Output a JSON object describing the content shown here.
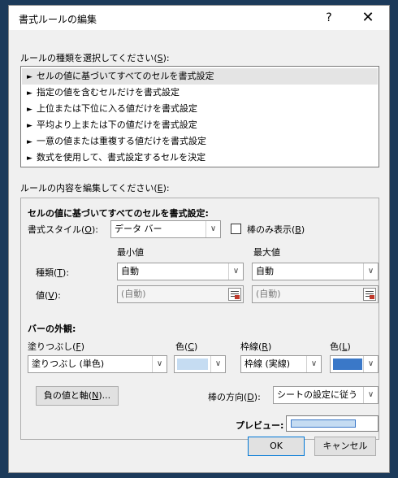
{
  "window": {
    "title": "書式ルールの編集",
    "help": "?",
    "close": "✕"
  },
  "rule_type_label": "ルールの種類を選択してください(",
  "rule_type_key": "S",
  "rule_type_suffix": "):",
  "rules": [
    "セルの値に基づいてすべてのセルを書式設定",
    "指定の値を含むセルだけを書式設定",
    "上位または下位に入る値だけを書式設定",
    "平均より上または下の値だけを書式設定",
    "一意の値または重複する値だけを書式設定",
    "数式を使用して、書式設定するセルを決定"
  ],
  "rule_arrow": "►",
  "edit_label": "ルールの内容を編集してください(",
  "edit_key": "E",
  "edit_suffix": "):",
  "edit": {
    "heading": "セルの値に基づいてすべてのセルを書式設定:",
    "format_style_label": "書式スタイル(",
    "format_style_key": "O",
    "format_style_suffix": "):",
    "format_style_value": "データ バー",
    "bar_only_label": "棒のみ表示(",
    "bar_only_key": "B",
    "bar_only_suffix": ")",
    "min_heading": "最小値",
    "max_heading": "最大値",
    "type_label": "種類(",
    "type_key": "T",
    "type_suffix": "):",
    "min_type": "自動",
    "max_type": "自動",
    "value_label": "値(",
    "value_key": "V",
    "value_suffix": "):",
    "min_value": "(自動)",
    "max_value": "(自動)"
  },
  "bar": {
    "heading": "バーの外観:",
    "fill_label": "塗りつぶし(",
    "fill_key": "F",
    "fill_suffix": ")",
    "fill_value": "塗りつぶし (単色)",
    "fill_color_label": "色(",
    "fill_color_key": "C",
    "fill_color_suffix": ")",
    "fill_color": "#c5dcf2",
    "border_label": "枠線(",
    "border_key": "R",
    "border_suffix": ")",
    "border_value": "枠線 (実線)",
    "border_color_label": "色(",
    "border_color_key": "L",
    "border_color_suffix": ")",
    "border_color": "#3a78c8",
    "neg_axis_button": "負の値と軸(",
    "neg_axis_key": "N",
    "neg_axis_suffix": ")...",
    "direction_label": "棒の方向(",
    "direction_key": "D",
    "direction_suffix": "):",
    "direction_value": "シートの設定に従う",
    "preview_label": "プレビュー:"
  },
  "buttons": {
    "ok": "OK",
    "cancel": "キャンセル"
  },
  "dropdown_arrow": "∨"
}
